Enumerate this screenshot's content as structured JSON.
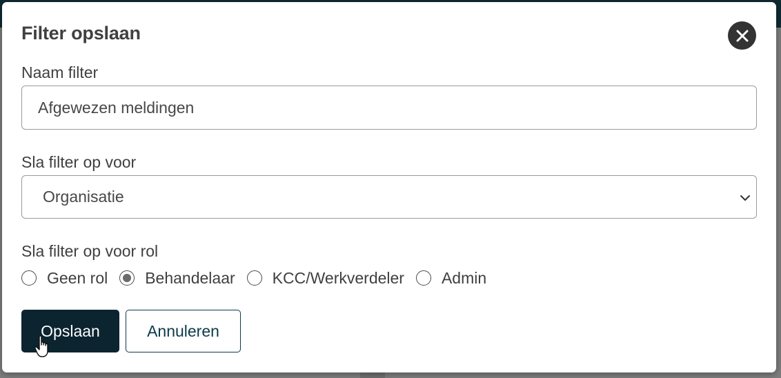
{
  "dialog": {
    "title": "Filter opslaan",
    "close_icon": "close-icon"
  },
  "name_field": {
    "label": "Naam filter",
    "value": "Afgewezen meldingen"
  },
  "save_for_field": {
    "label": "Sla filter op voor",
    "selected": "Organisatie"
  },
  "role_field": {
    "label": "Sla filter op voor rol",
    "options": [
      {
        "label": "Geen rol",
        "checked": false
      },
      {
        "label": "Behandelaar",
        "checked": true
      },
      {
        "label": "KCC/Werkverdeler",
        "checked": false
      },
      {
        "label": "Admin",
        "checked": false
      }
    ]
  },
  "actions": {
    "save_label": "Opslaan",
    "cancel_label": "Annuleren"
  },
  "colors": {
    "primary": "#0b2430",
    "secondary_border": "#0c3a4a",
    "close_bg": "#333333",
    "backdrop": "#7b7b7b"
  }
}
